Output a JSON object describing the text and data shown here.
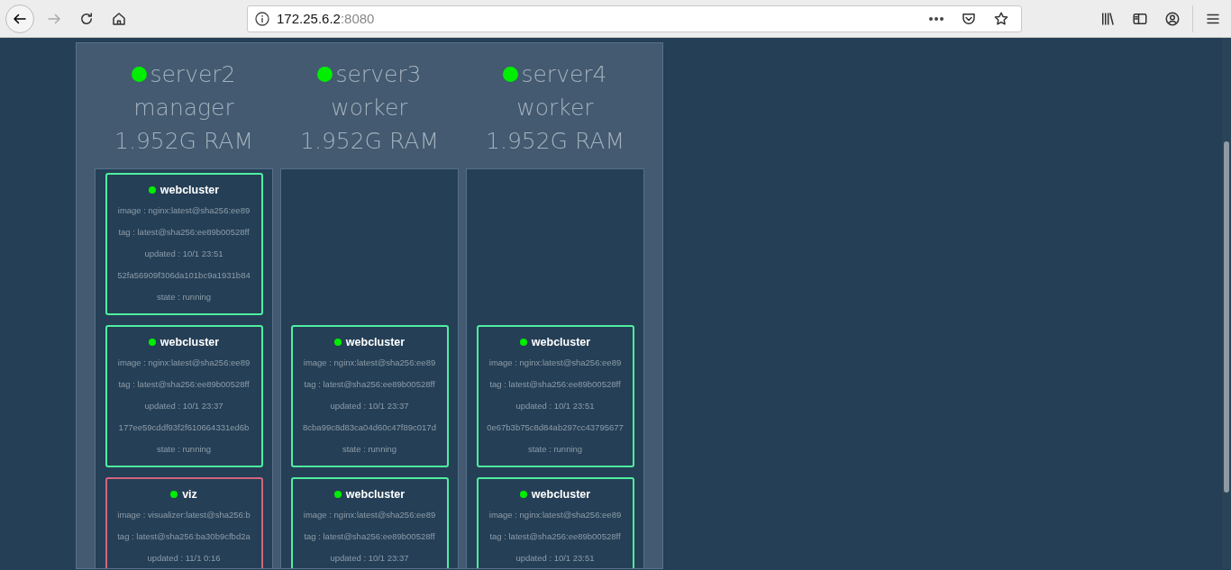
{
  "browser": {
    "url_host": "172.25.6.2",
    "url_port": ":8080"
  },
  "nodes": [
    {
      "name": "server2",
      "role": "manager",
      "ram": "1.952G RAM",
      "tasks": [
        {
          "name": "webcluster",
          "color": "#4ef0a0",
          "lines": [
            "image : nginx:latest@sha256:ee89",
            "tag : latest@sha256:ee89b00528ff",
            "updated : 10/1 23:51",
            "52fa56909f306da101bc9a1931b84",
            "state : running"
          ]
        },
        {
          "name": "webcluster",
          "color": "#4ef0a0",
          "lines": [
            "image : nginx:latest@sha256:ee89",
            "tag : latest@sha256:ee89b00528ff",
            "updated : 10/1 23:37",
            "177ee59cddf93f2f610664331ed6b",
            "state : running"
          ]
        },
        {
          "name": "viz",
          "color": "#d2667c",
          "lines": [
            "image : visualizer:latest@sha256:b",
            "tag : latest@sha256:ba30b9cfbd2a",
            "updated : 11/1 0:16"
          ]
        }
      ]
    },
    {
      "name": "server3",
      "role": "worker",
      "ram": "1.952G RAM",
      "tasks": [
        {
          "name": "webcluster",
          "color": "#4ef0a0",
          "lines": [
            "image : nginx:latest@sha256:ee89",
            "tag : latest@sha256:ee89b00528ff",
            "updated : 10/1 23:37",
            "8cba99c8d83ca04d60c47f89c017d",
            "state : running"
          ]
        },
        {
          "name": "webcluster",
          "color": "#4ef0a0",
          "lines": [
            "image : nginx:latest@sha256:ee89",
            "tag : latest@sha256:ee89b00528ff",
            "updated : 10/1 23:37"
          ]
        }
      ]
    },
    {
      "name": "server4",
      "role": "worker",
      "ram": "1.952G RAM",
      "tasks": [
        {
          "name": "webcluster",
          "color": "#4ef0a0",
          "lines": [
            "image : nginx:latest@sha256:ee89",
            "tag : latest@sha256:ee89b00528ff",
            "updated : 10/1 23:51",
            "0e67b3b75c8d84ab297cc43795677",
            "state : running"
          ]
        },
        {
          "name": "webcluster",
          "color": "#4ef0a0",
          "lines": [
            "image : nginx:latest@sha256:ee89",
            "tag : latest@sha256:ee89b00528ff",
            "updated : 10/1 23:51"
          ]
        }
      ]
    }
  ]
}
